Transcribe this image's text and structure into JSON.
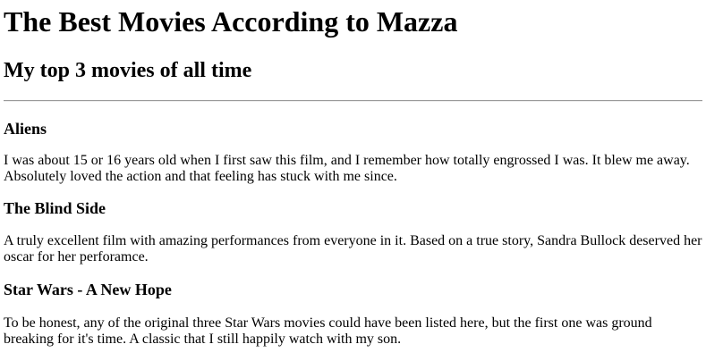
{
  "page": {
    "title": "The Best Movies According to Mazza",
    "subtitle": "My top 3 movies of all time"
  },
  "movies": [
    {
      "title": "Aliens",
      "description": "I was about 15 or 16 years old when I first saw this film, and I remember how totally engrossed I was. It blew me away. Absolutely loved the action and that feeling has stuck with me since."
    },
    {
      "title": "The Blind Side",
      "description": "A truly excellent film with amazing performances from everyone in it. Based on a true story, Sandra Bullock deserved her oscar for her perforamce."
    },
    {
      "title": "Star Wars - A New Hope",
      "description": "To be honest, any of the original three Star Wars movies could have been listed here, but the first one was ground breaking for it's time. A classic that I still happily watch with my son."
    }
  ]
}
